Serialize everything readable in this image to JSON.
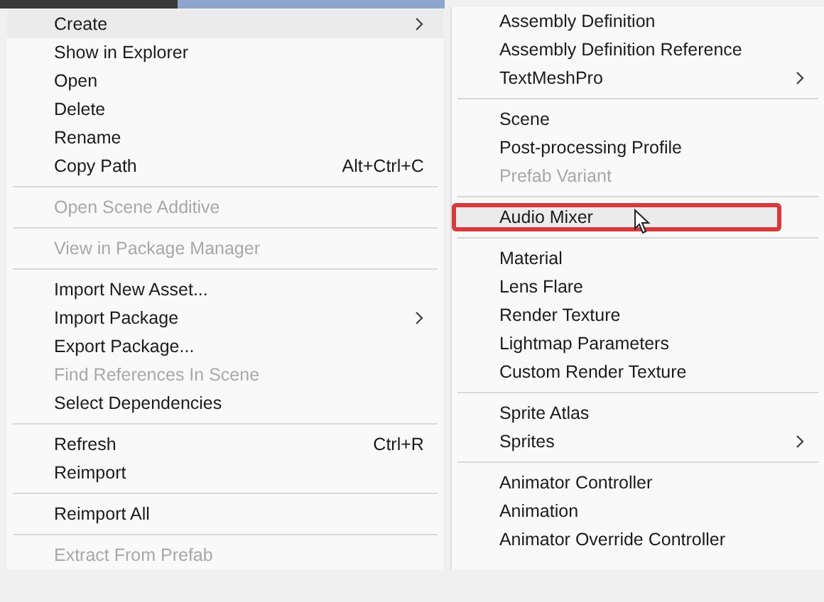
{
  "menus": [
    {
      "items": [
        {
          "kind": "item",
          "label": "Create",
          "submenu": true,
          "disabled": false,
          "selected": true,
          "outlined": false
        },
        {
          "kind": "item",
          "label": "Show in Explorer",
          "submenu": false,
          "disabled": false,
          "selected": false,
          "outlined": false
        },
        {
          "kind": "item",
          "label": "Open",
          "submenu": false,
          "disabled": false,
          "selected": false,
          "outlined": false
        },
        {
          "kind": "item",
          "label": "Delete",
          "submenu": false,
          "disabled": false,
          "selected": false,
          "outlined": false
        },
        {
          "kind": "item",
          "label": "Rename",
          "submenu": false,
          "disabled": false,
          "selected": false,
          "outlined": false
        },
        {
          "kind": "item",
          "label": "Copy Path",
          "shortcut": "Alt+Ctrl+C",
          "submenu": false,
          "disabled": false,
          "selected": false,
          "outlined": false
        },
        {
          "kind": "separator"
        },
        {
          "kind": "item",
          "label": "Open Scene Additive",
          "submenu": false,
          "disabled": true,
          "selected": false,
          "outlined": false
        },
        {
          "kind": "separator"
        },
        {
          "kind": "item",
          "label": "View in Package Manager",
          "submenu": false,
          "disabled": true,
          "selected": false,
          "outlined": false
        },
        {
          "kind": "separator"
        },
        {
          "kind": "item",
          "label": "Import New Asset...",
          "submenu": false,
          "disabled": false,
          "selected": false,
          "outlined": false
        },
        {
          "kind": "item",
          "label": "Import Package",
          "submenu": true,
          "disabled": false,
          "selected": false,
          "outlined": false
        },
        {
          "kind": "item",
          "label": "Export Package...",
          "submenu": false,
          "disabled": false,
          "selected": false,
          "outlined": false
        },
        {
          "kind": "item",
          "label": "Find References In Scene",
          "submenu": false,
          "disabled": true,
          "selected": false,
          "outlined": false
        },
        {
          "kind": "item",
          "label": "Select Dependencies",
          "submenu": false,
          "disabled": false,
          "selected": false,
          "outlined": false
        },
        {
          "kind": "separator"
        },
        {
          "kind": "item",
          "label": "Refresh",
          "shortcut": "Ctrl+R",
          "submenu": false,
          "disabled": false,
          "selected": false,
          "outlined": false
        },
        {
          "kind": "item",
          "label": "Reimport",
          "submenu": false,
          "disabled": false,
          "selected": false,
          "outlined": false
        },
        {
          "kind": "separator"
        },
        {
          "kind": "item",
          "label": "Reimport All",
          "submenu": false,
          "disabled": false,
          "selected": false,
          "outlined": false
        },
        {
          "kind": "separator"
        },
        {
          "kind": "item",
          "label": "Extract From Prefab",
          "submenu": false,
          "disabled": true,
          "selected": false,
          "outlined": false
        }
      ]
    },
    {
      "items": [
        {
          "kind": "item",
          "label": "Assembly Definition",
          "submenu": false,
          "disabled": false,
          "selected": false,
          "outlined": false
        },
        {
          "kind": "item",
          "label": "Assembly Definition Reference",
          "submenu": false,
          "disabled": false,
          "selected": false,
          "outlined": false
        },
        {
          "kind": "item",
          "label": "TextMeshPro",
          "submenu": true,
          "disabled": false,
          "selected": false,
          "outlined": false
        },
        {
          "kind": "separator"
        },
        {
          "kind": "item",
          "label": "Scene",
          "submenu": false,
          "disabled": false,
          "selected": false,
          "outlined": false
        },
        {
          "kind": "item",
          "label": "Post-processing Profile",
          "submenu": false,
          "disabled": false,
          "selected": false,
          "outlined": false
        },
        {
          "kind": "item",
          "label": "Prefab Variant",
          "submenu": false,
          "disabled": true,
          "selected": false,
          "outlined": false
        },
        {
          "kind": "separator"
        },
        {
          "kind": "item",
          "label": "Audio Mixer",
          "submenu": false,
          "disabled": false,
          "selected": true,
          "outlined": true
        },
        {
          "kind": "separator"
        },
        {
          "kind": "item",
          "label": "Material",
          "submenu": false,
          "disabled": false,
          "selected": false,
          "outlined": false
        },
        {
          "kind": "item",
          "label": "Lens Flare",
          "submenu": false,
          "disabled": false,
          "selected": false,
          "outlined": false
        },
        {
          "kind": "item",
          "label": "Render Texture",
          "submenu": false,
          "disabled": false,
          "selected": false,
          "outlined": false
        },
        {
          "kind": "item",
          "label": "Lightmap Parameters",
          "submenu": false,
          "disabled": false,
          "selected": false,
          "outlined": false
        },
        {
          "kind": "item",
          "label": "Custom Render Texture",
          "submenu": false,
          "disabled": false,
          "selected": false,
          "outlined": false
        },
        {
          "kind": "separator"
        },
        {
          "kind": "item",
          "label": "Sprite Atlas",
          "submenu": false,
          "disabled": false,
          "selected": false,
          "outlined": false
        },
        {
          "kind": "item",
          "label": "Sprites",
          "submenu": true,
          "disabled": false,
          "selected": false,
          "outlined": false
        },
        {
          "kind": "separator"
        },
        {
          "kind": "item",
          "label": "Animator Controller",
          "submenu": false,
          "disabled": false,
          "selected": false,
          "outlined": false
        },
        {
          "kind": "item",
          "label": "Animation",
          "submenu": false,
          "disabled": false,
          "selected": false,
          "outlined": false
        },
        {
          "kind": "item",
          "label": "Animator Override Controller",
          "submenu": false,
          "disabled": false,
          "selected": false,
          "outlined": false
        }
      ]
    }
  ]
}
